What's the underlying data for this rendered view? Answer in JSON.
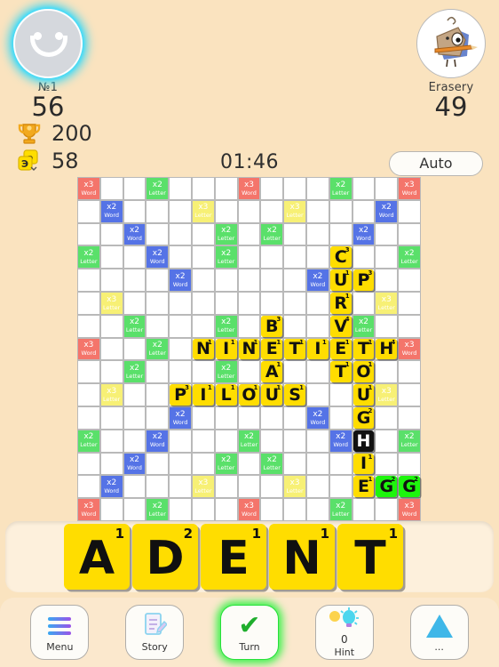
{
  "players": {
    "p1": {
      "name": "№1",
      "score": "56",
      "avatar_icon": "smiley-face-avatar"
    },
    "p2": {
      "name": "Erasery",
      "score": "49",
      "avatar_icon": "eraser-character-avatar"
    }
  },
  "stats": [
    {
      "icon": "trophy-icon",
      "value": "200"
    },
    {
      "icon": "tile-bag-icon",
      "value": "58"
    }
  ],
  "timer": {
    "value": "01:46"
  },
  "auto_button": {
    "label": "Auto"
  },
  "board": {
    "size": 15,
    "bonus_legend": {
      "3w": "x3 Word",
      "2w": "x2 Word",
      "2l": "x2 Letter",
      "3l": "x3 Letter"
    },
    "bonuses": [
      {
        "r": 0,
        "c": 0,
        "t": "3w"
      },
      {
        "r": 0,
        "c": 3,
        "t": "2l"
      },
      {
        "r": 0,
        "c": 7,
        "t": "3w"
      },
      {
        "r": 0,
        "c": 11,
        "t": "2l"
      },
      {
        "r": 0,
        "c": 14,
        "t": "3w"
      },
      {
        "r": 1,
        "c": 1,
        "t": "2w"
      },
      {
        "r": 1,
        "c": 5,
        "t": "3l"
      },
      {
        "r": 1,
        "c": 9,
        "t": "3l"
      },
      {
        "r": 1,
        "c": 13,
        "t": "2w"
      },
      {
        "r": 2,
        "c": 2,
        "t": "2w"
      },
      {
        "r": 2,
        "c": 6,
        "t": "2l"
      },
      {
        "r": 2,
        "c": 8,
        "t": "2l"
      },
      {
        "r": 2,
        "c": 12,
        "t": "2w"
      },
      {
        "r": 3,
        "c": 0,
        "t": "2l"
      },
      {
        "r": 3,
        "c": 3,
        "t": "2w"
      },
      {
        "r": 3,
        "c": 6,
        "t": "2l"
      },
      {
        "r": 3,
        "c": 14,
        "t": "2l"
      },
      {
        "r": 4,
        "c": 4,
        "t": "2w"
      },
      {
        "r": 4,
        "c": 10,
        "t": "2w"
      },
      {
        "r": 5,
        "c": 1,
        "t": "3l"
      },
      {
        "r": 5,
        "c": 13,
        "t": "3l"
      },
      {
        "r": 6,
        "c": 2,
        "t": "2l"
      },
      {
        "r": 6,
        "c": 6,
        "t": "2l"
      },
      {
        "r": 6,
        "c": 12,
        "t": "2l"
      },
      {
        "r": 7,
        "c": 0,
        "t": "3w"
      },
      {
        "r": 7,
        "c": 3,
        "t": "2l"
      },
      {
        "r": 7,
        "c": 14,
        "t": "3w"
      },
      {
        "r": 8,
        "c": 2,
        "t": "2l"
      },
      {
        "r": 8,
        "c": 6,
        "t": "2l"
      },
      {
        "r": 9,
        "c": 1,
        "t": "3l"
      },
      {
        "r": 9,
        "c": 13,
        "t": "3l"
      },
      {
        "r": 10,
        "c": 4,
        "t": "2w"
      },
      {
        "r": 10,
        "c": 10,
        "t": "2w"
      },
      {
        "r": 11,
        "c": 0,
        "t": "2l"
      },
      {
        "r": 11,
        "c": 3,
        "t": "2w"
      },
      {
        "r": 11,
        "c": 7,
        "t": "2l"
      },
      {
        "r": 11,
        "c": 11,
        "t": "2w"
      },
      {
        "r": 11,
        "c": 14,
        "t": "2l"
      },
      {
        "r": 12,
        "c": 2,
        "t": "2w"
      },
      {
        "r": 12,
        "c": 6,
        "t": "2l"
      },
      {
        "r": 12,
        "c": 8,
        "t": "2l"
      },
      {
        "r": 13,
        "c": 1,
        "t": "2w"
      },
      {
        "r": 13,
        "c": 5,
        "t": "3l"
      },
      {
        "r": 13,
        "c": 9,
        "t": "3l"
      },
      {
        "r": 14,
        "c": 0,
        "t": "3w"
      },
      {
        "r": 14,
        "c": 3,
        "t": "2l"
      },
      {
        "r": 14,
        "c": 7,
        "t": "3w"
      },
      {
        "r": 14,
        "c": 11,
        "t": "2l"
      },
      {
        "r": 14,
        "c": 14,
        "t": "3w"
      }
    ],
    "tiles": [
      {
        "r": 3,
        "c": 11,
        "ch": "C",
        "pt": "3",
        "state": "placed"
      },
      {
        "r": 4,
        "c": 11,
        "ch": "U",
        "pt": "1",
        "state": "placed"
      },
      {
        "r": 4,
        "c": 12,
        "ch": "P",
        "pt": "3",
        "state": "placed"
      },
      {
        "r": 5,
        "c": 11,
        "ch": "R",
        "pt": "1",
        "state": "placed"
      },
      {
        "r": 6,
        "c": 11,
        "ch": "V",
        "pt": "4",
        "state": "placed"
      },
      {
        "r": 6,
        "c": 8,
        "ch": "B",
        "pt": "3",
        "state": "placed"
      },
      {
        "r": 7,
        "c": 5,
        "ch": "N",
        "pt": "1",
        "state": "placed"
      },
      {
        "r": 7,
        "c": 6,
        "ch": "I",
        "pt": "1",
        "state": "placed"
      },
      {
        "r": 7,
        "c": 7,
        "ch": "N",
        "pt": "1",
        "state": "placed"
      },
      {
        "r": 7,
        "c": 8,
        "ch": "E",
        "pt": "1",
        "state": "placed"
      },
      {
        "r": 7,
        "c": 9,
        "ch": "T",
        "pt": "1",
        "state": "placed"
      },
      {
        "r": 7,
        "c": 10,
        "ch": "I",
        "pt": "1",
        "state": "placed"
      },
      {
        "r": 7,
        "c": 11,
        "ch": "E",
        "pt": "1",
        "state": "placed"
      },
      {
        "r": 7,
        "c": 12,
        "ch": "T",
        "pt": "1",
        "state": "placed"
      },
      {
        "r": 7,
        "c": 13,
        "ch": "H",
        "pt": "4",
        "state": "placed"
      },
      {
        "r": 8,
        "c": 8,
        "ch": "A",
        "pt": "1",
        "state": "placed"
      },
      {
        "r": 8,
        "c": 11,
        "ch": "T",
        "pt": "1",
        "state": "placed"
      },
      {
        "r": 8,
        "c": 12,
        "ch": "O",
        "pt": "1",
        "state": "placed"
      },
      {
        "r": 9,
        "c": 4,
        "ch": "P",
        "pt": "3",
        "state": "placed"
      },
      {
        "r": 9,
        "c": 5,
        "ch": "I",
        "pt": "1",
        "state": "placed"
      },
      {
        "r": 9,
        "c": 6,
        "ch": "L",
        "pt": "1",
        "state": "placed"
      },
      {
        "r": 9,
        "c": 7,
        "ch": "O",
        "pt": "1",
        "state": "placed"
      },
      {
        "r": 9,
        "c": 8,
        "ch": "U",
        "pt": "1",
        "state": "placed"
      },
      {
        "r": 9,
        "c": 9,
        "ch": "S",
        "pt": "1",
        "state": "placed"
      },
      {
        "r": 9,
        "c": 12,
        "ch": "U",
        "pt": "1",
        "state": "placed"
      },
      {
        "r": 10,
        "c": 12,
        "ch": "G",
        "pt": "2",
        "state": "placed"
      },
      {
        "r": 11,
        "c": 12,
        "ch": "H",
        "pt": "",
        "state": "blank"
      },
      {
        "r": 12,
        "c": 12,
        "ch": "I",
        "pt": "1",
        "state": "placed"
      },
      {
        "r": 13,
        "c": 12,
        "ch": "E",
        "pt": "1",
        "state": "placed"
      },
      {
        "r": 13,
        "c": 13,
        "ch": "G",
        "pt": "2",
        "state": "new"
      },
      {
        "r": 13,
        "c": 14,
        "ch": "G",
        "pt": "2",
        "state": "new"
      }
    ]
  },
  "rack": {
    "tiles": [
      {
        "ch": "A",
        "pt": "1"
      },
      {
        "ch": "D",
        "pt": "2"
      },
      {
        "ch": "E",
        "pt": "1"
      },
      {
        "ch": "N",
        "pt": "1"
      },
      {
        "ch": "T",
        "pt": "1"
      }
    ]
  },
  "bottom_bar": {
    "buttons": [
      {
        "name": "menu",
        "label": "Menu",
        "icon": "hamburger-icon",
        "sub": "",
        "active": false
      },
      {
        "name": "story",
        "label": "Story",
        "icon": "notepad-pencil-icon",
        "sub": "",
        "active": false
      },
      {
        "name": "turn",
        "label": "Turn",
        "icon": "check-icon",
        "sub": "",
        "active": true
      },
      {
        "name": "hint",
        "label": "Hint",
        "icon": "lightbulb-icon",
        "sub": "0",
        "active": false
      },
      {
        "name": "more",
        "label": "...",
        "icon": "triangle-icon",
        "sub": "",
        "active": false
      }
    ]
  },
  "colors": {
    "background": "#fae3bf",
    "tile": "#ffdd00",
    "tile_new": "#1ef50d",
    "triple_word": "#f4756b",
    "double_word": "#5573e6",
    "double_letter": "#5ae06a",
    "triple_letter": "#f7f075",
    "accent_green": "#26e03a",
    "accent_cyan": "#34d7f7"
  }
}
